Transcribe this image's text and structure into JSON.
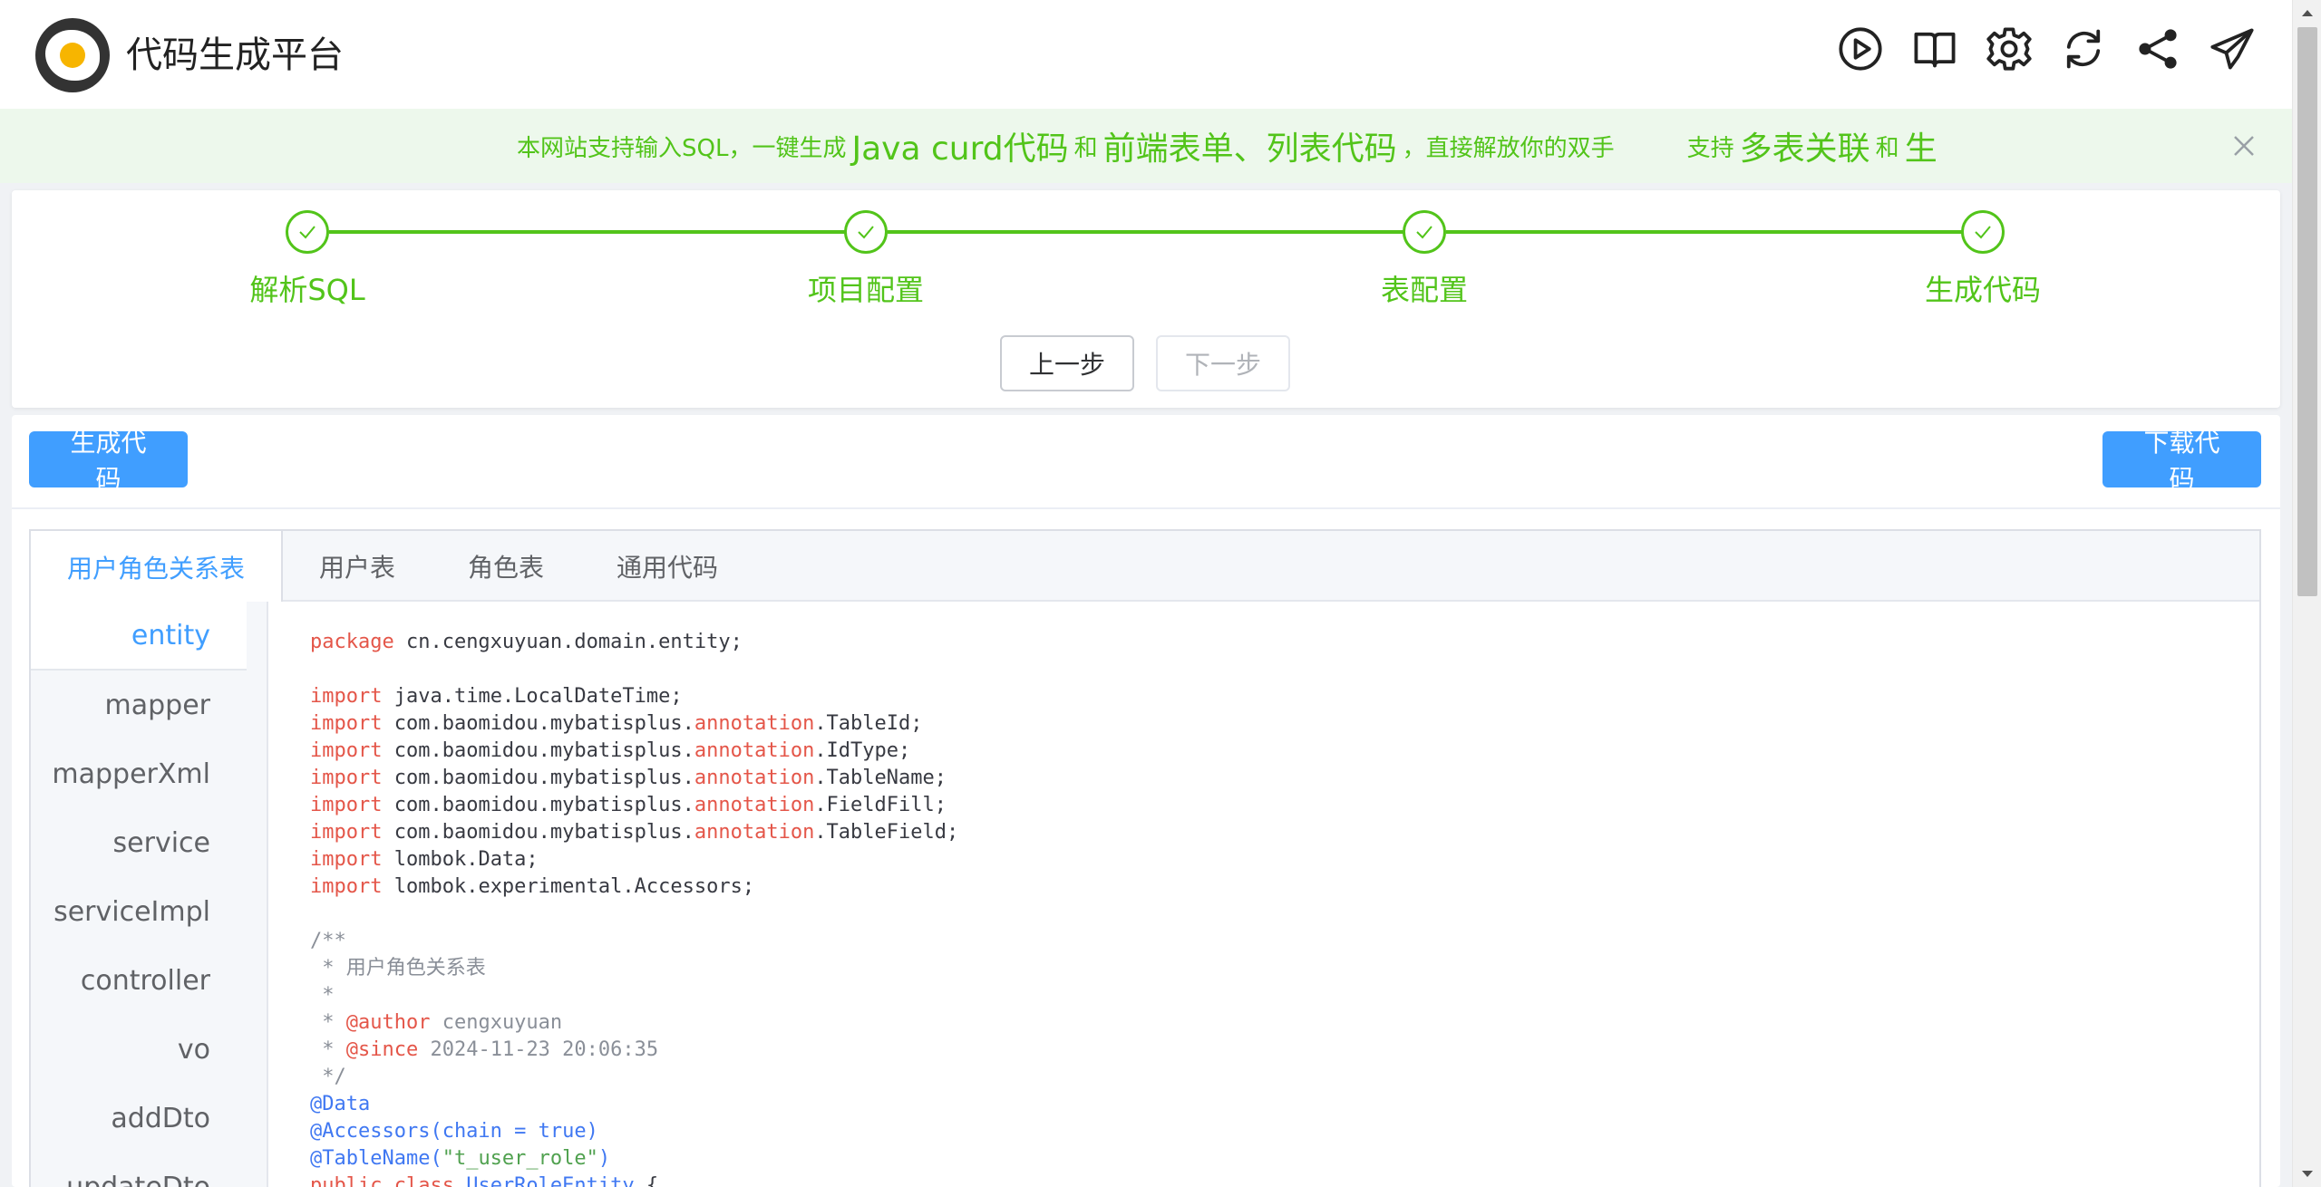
{
  "app": {
    "title": "代码生成平台"
  },
  "header_icons": [
    "play-icon",
    "book-icon",
    "gear-icon",
    "refresh-icon",
    "share-icon",
    "send-icon"
  ],
  "notice": {
    "segments": [
      {
        "text": "本网站支持输入SQL，一键生成",
        "size": "sm"
      },
      {
        "text": "Java curd代码",
        "size": "lg"
      },
      {
        "text": "和",
        "size": "sm"
      },
      {
        "text": "前端表单、列表代码",
        "size": "lg"
      },
      {
        "text": "，直接解放你的双手",
        "size": "sm"
      },
      {
        "text": "支持",
        "size": "sm"
      },
      {
        "text": "多表关联",
        "size": "lg"
      },
      {
        "text": "和",
        "size": "sm"
      },
      {
        "text": "生",
        "size": "lg"
      }
    ],
    "close_icon": "close-icon"
  },
  "steps": {
    "items": [
      "解析SQL",
      "项目配置",
      "表配置",
      "生成代码"
    ],
    "prev_label": "上一步",
    "next_label": "下一步",
    "active_color": "#52c41a"
  },
  "actions": {
    "generate_label": "生成代码",
    "download_label": "下载代码",
    "primary_color": "#409eff"
  },
  "tabs": [
    "用户角色关系表",
    "用户表",
    "角色表",
    "通用代码"
  ],
  "active_tab": 0,
  "sidebar": [
    "entity",
    "mapper",
    "mapperXml",
    "service",
    "serviceImpl",
    "controller",
    "vo",
    "addDto",
    "updateDto"
  ],
  "active_side": 0,
  "code_lines": [
    [
      [
        "kw",
        "package"
      ],
      [
        "",
        " cn.cengxuyuan.domain.entity;"
      ]
    ],
    [],
    [
      [
        "kw",
        "import"
      ],
      [
        "",
        " java.time.LocalDateTime;"
      ]
    ],
    [
      [
        "kw",
        "import"
      ],
      [
        "",
        " com.baomidou.mybatisplus."
      ],
      [
        "kw",
        "annotation"
      ],
      [
        "",
        ".TableId;"
      ]
    ],
    [
      [
        "kw",
        "import"
      ],
      [
        "",
        " com.baomidou.mybatisplus."
      ],
      [
        "kw",
        "annotation"
      ],
      [
        "",
        ".IdType;"
      ]
    ],
    [
      [
        "kw",
        "import"
      ],
      [
        "",
        " com.baomidou.mybatisplus."
      ],
      [
        "kw",
        "annotation"
      ],
      [
        "",
        ".TableName;"
      ]
    ],
    [
      [
        "kw",
        "import"
      ],
      [
        "",
        " com.baomidou.mybatisplus."
      ],
      [
        "kw",
        "annotation"
      ],
      [
        "",
        ".FieldFill;"
      ]
    ],
    [
      [
        "kw",
        "import"
      ],
      [
        "",
        " com.baomidou.mybatisplus."
      ],
      [
        "kw",
        "annotation"
      ],
      [
        "",
        ".TableField;"
      ]
    ],
    [
      [
        "kw",
        "import"
      ],
      [
        "",
        " lombok.Data;"
      ]
    ],
    [
      [
        "kw",
        "import"
      ],
      [
        "",
        " lombok.experimental.Accessors;"
      ]
    ],
    [],
    [
      [
        "cm",
        "/**"
      ]
    ],
    [
      [
        "cm",
        " * 用户角色关系表"
      ]
    ],
    [
      [
        "cm",
        " *"
      ]
    ],
    [
      [
        "cm",
        " * "
      ],
      [
        "kw",
        "@author"
      ],
      [
        "cm",
        " cengxuyuan"
      ]
    ],
    [
      [
        "cm",
        " * "
      ],
      [
        "kw",
        "@since"
      ],
      [
        "cm",
        " 2024-11-23 20:06:35"
      ]
    ],
    [
      [
        "cm",
        " */"
      ]
    ],
    [
      [
        "an",
        "@Data"
      ]
    ],
    [
      [
        "an",
        "@Accessors(chain = true)"
      ]
    ],
    [
      [
        "an",
        "@TableName("
      ],
      [
        "st",
        "\"t_user_role\""
      ],
      [
        "an",
        ")"
      ]
    ],
    [
      [
        "kw",
        "public class"
      ],
      [
        "",
        " "
      ],
      [
        "an",
        "UserRoleEntity"
      ],
      [
        "",
        " {"
      ]
    ]
  ]
}
